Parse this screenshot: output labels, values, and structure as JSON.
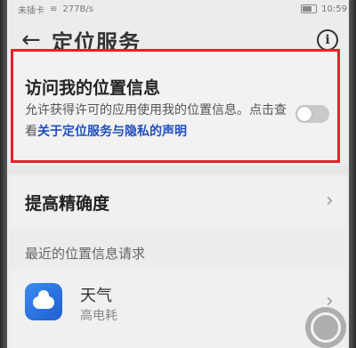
{
  "status_bar": {
    "carrier": "未插卡",
    "speed": "277B/s",
    "time": "10:59"
  },
  "header": {
    "back_icon": "back-arrow-icon",
    "title": "定位服务",
    "info_icon": "info-icon"
  },
  "location_access": {
    "title": "访问我的位置信息",
    "description_part1": "允许获得许可的应用使用我的位置信息。点击查看",
    "link_text": "关于定位服务与隐私的声明",
    "toggle_on": false
  },
  "accuracy": {
    "label": "提高精确度"
  },
  "recent_requests": {
    "header": "最近的位置信息请求",
    "apps": [
      {
        "name": "天气",
        "usage": "高电耗",
        "icon": "weather-icon"
      }
    ]
  },
  "colors": {
    "highlight": "#e8202a",
    "link": "#1f4fbf"
  }
}
